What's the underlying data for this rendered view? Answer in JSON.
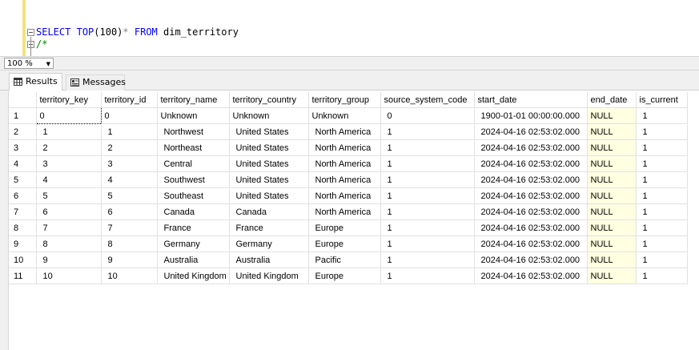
{
  "editor": {
    "line1": {
      "kw1": "SELECT",
      "kw2": "TOP",
      "num": "(100)",
      "star": "*",
      "kw3": "FROM",
      "table": "dim_territory"
    },
    "line2": {
      "comment": "/*"
    }
  },
  "zoom": {
    "value": "100 %"
  },
  "tabs": [
    {
      "label": "Results",
      "icon": "grid-icon"
    },
    {
      "label": "Messages",
      "icon": "messages-icon"
    }
  ],
  "grid": {
    "columns": [
      "territory_key",
      "territory_id",
      "territory_name",
      "territory_country",
      "territory_group",
      "source_system_code",
      "start_date",
      "end_date",
      "is_current"
    ],
    "rows": [
      {
        "n": "1",
        "cells": [
          "0",
          "0",
          "Unknown",
          "Unknown",
          "Unknown",
          "0",
          "1900-01-01 00:00:00.000",
          "NULL",
          "1"
        ]
      },
      {
        "n": "2",
        "cells": [
          "1",
          "1",
          "Northwest",
          "United States",
          "North America",
          "1",
          "2024-04-16 02:53:02.000",
          "NULL",
          "1"
        ]
      },
      {
        "n": "3",
        "cells": [
          "2",
          "2",
          "Northeast",
          "United States",
          "North America",
          "1",
          "2024-04-16 02:53:02.000",
          "NULL",
          "1"
        ]
      },
      {
        "n": "4",
        "cells": [
          "3",
          "3",
          "Central",
          "United States",
          "North America",
          "1",
          "2024-04-16 02:53:02.000",
          "NULL",
          "1"
        ]
      },
      {
        "n": "5",
        "cells": [
          "4",
          "4",
          "Southwest",
          "United States",
          "North America",
          "1",
          "2024-04-16 02:53:02.000",
          "NULL",
          "1"
        ]
      },
      {
        "n": "6",
        "cells": [
          "5",
          "5",
          "Southeast",
          "United States",
          "North America",
          "1",
          "2024-04-16 02:53:02.000",
          "NULL",
          "1"
        ]
      },
      {
        "n": "7",
        "cells": [
          "6",
          "6",
          "Canada",
          "Canada",
          "North America",
          "1",
          "2024-04-16 02:53:02.000",
          "NULL",
          "1"
        ]
      },
      {
        "n": "8",
        "cells": [
          "7",
          "7",
          "France",
          "France",
          "Europe",
          "1",
          "2024-04-16 02:53:02.000",
          "NULL",
          "1"
        ]
      },
      {
        "n": "9",
        "cells": [
          "8",
          "8",
          "Germany",
          "Germany",
          "Europe",
          "1",
          "2024-04-16 02:53:02.000",
          "NULL",
          "1"
        ]
      },
      {
        "n": "10",
        "cells": [
          "9",
          "9",
          "Australia",
          "Australia",
          "Pacific",
          "1",
          "2024-04-16 02:53:02.000",
          "NULL",
          "1"
        ]
      },
      {
        "n": "11",
        "cells": [
          "10",
          "10",
          "United Kingdom",
          "United Kingdom",
          "Europe",
          "1",
          "2024-04-16 02:53:02.000",
          "NULL",
          "1"
        ]
      }
    ]
  }
}
